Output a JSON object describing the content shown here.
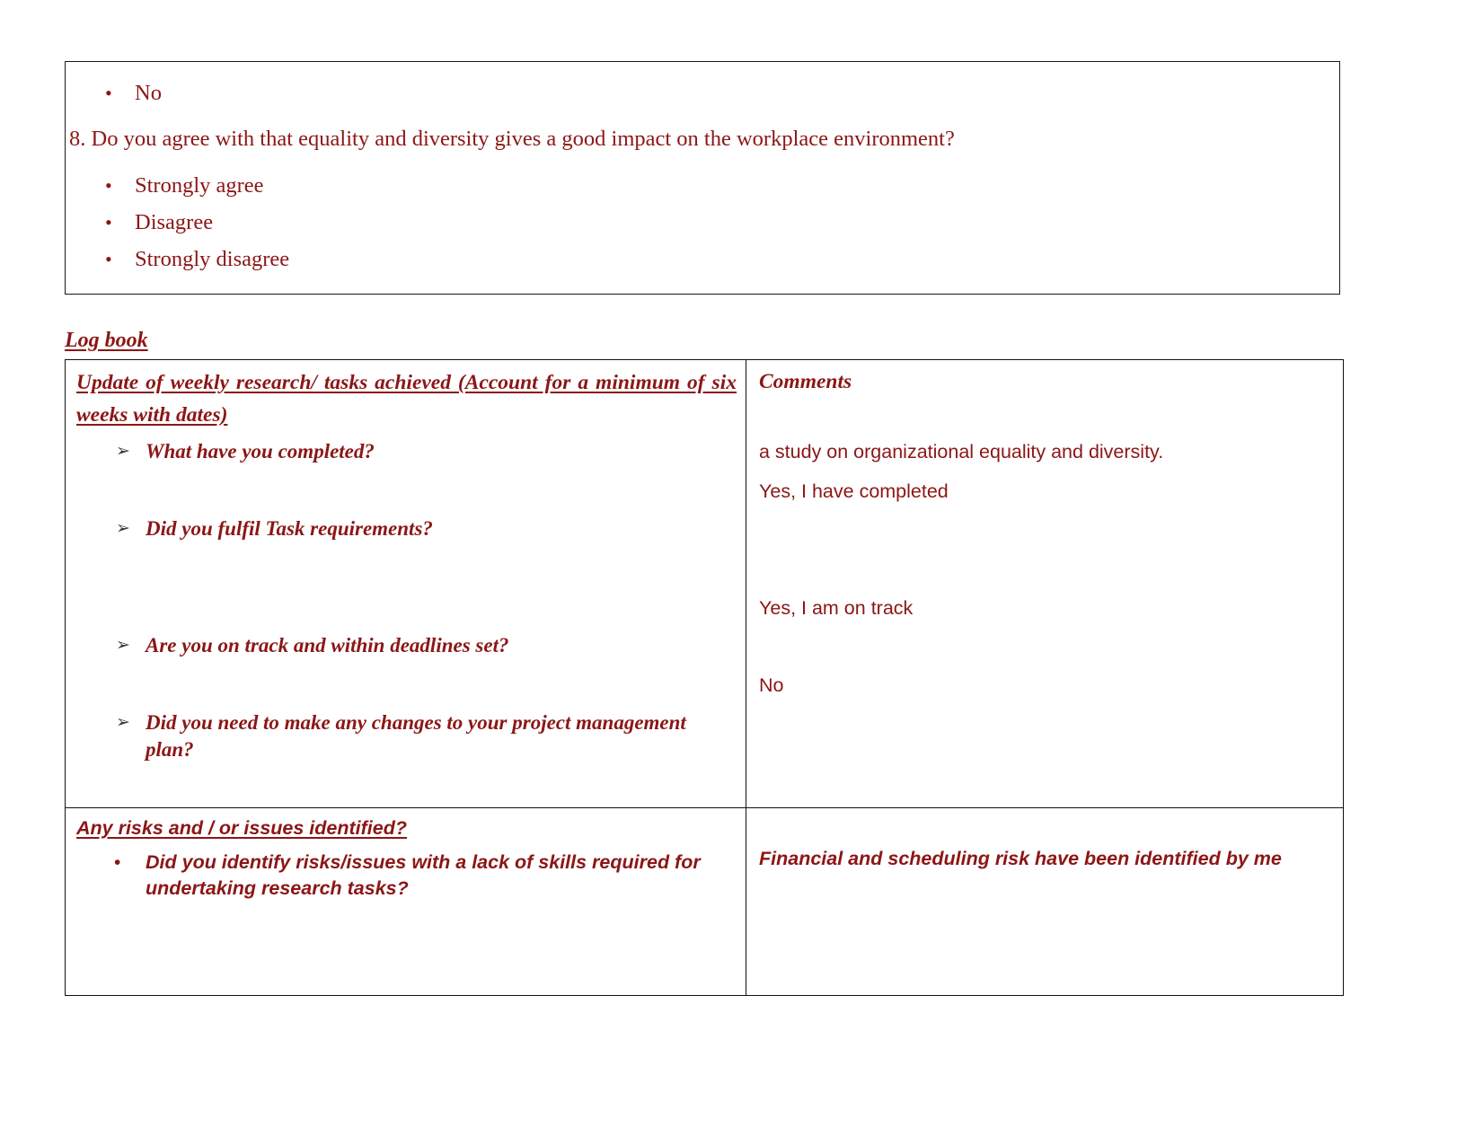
{
  "survey": {
    "leading_option": "No",
    "question": "8. Do you agree with that equality and diversity gives a good impact on the workplace environment?",
    "options": [
      "Strongly agree",
      "Disagree",
      "Strongly disagree"
    ],
    "bullet_glyph": "•"
  },
  "logbook": {
    "section_heading": "Log book",
    "columns": {
      "left_header": "Update of weekly research/ tasks achieved (Account for a minimum of six weeks with dates)",
      "right_header": "Comments"
    },
    "arrow_glyph": "➢",
    "bullet_glyph": "•",
    "weekly_questions": [
      "What have you completed?",
      "Did you fulfil Task requirements?",
      "Are you on track and within deadlines set?",
      "Did you need to make any changes to your project management plan?"
    ],
    "weekly_comments": [
      "a study on organizational equality and diversity.",
      "Yes, I have completed",
      "Yes, I am on track",
      "No"
    ],
    "risks": {
      "header": "Any risks and / or issues identified?",
      "question": "Did you identify risks/issues with a lack of skills required for undertaking research tasks?",
      "comment": "Financial and scheduling risk have been identified by me"
    }
  },
  "theme": {
    "text_color": "#8c1616",
    "border_color": "#111111",
    "page_background": "#ffffff"
  }
}
